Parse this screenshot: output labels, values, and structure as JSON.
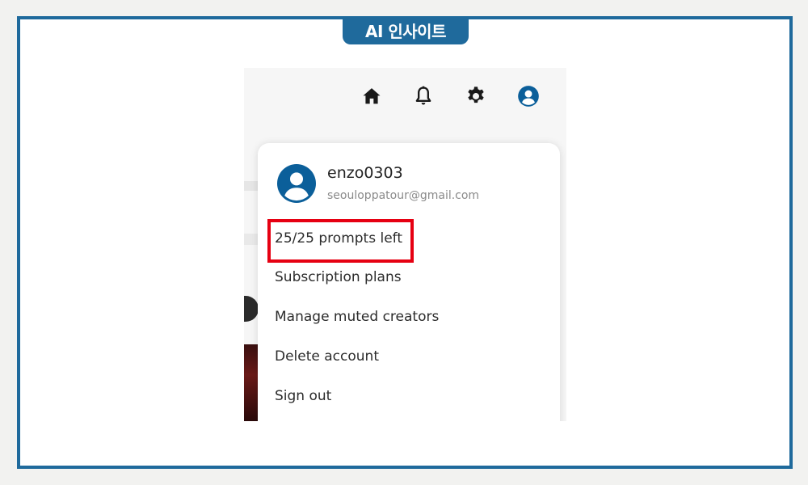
{
  "badge": {
    "label": "AI 인사이트"
  },
  "topbar": {
    "icons": [
      "home-icon",
      "bell-icon",
      "gear-icon",
      "user-avatar-icon"
    ]
  },
  "menu": {
    "username": "enzo0303",
    "email": "seouloppatour@gmail.com",
    "items": [
      {
        "label": "25/25 prompts left"
      },
      {
        "label": "Subscription plans"
      },
      {
        "label": "Manage muted creators"
      },
      {
        "label": "Delete account"
      },
      {
        "label": "Sign out"
      }
    ]
  },
  "colors": {
    "frame": "#1f6a9c",
    "avatar": "#0b5f9a",
    "highlight": "#e60012"
  }
}
